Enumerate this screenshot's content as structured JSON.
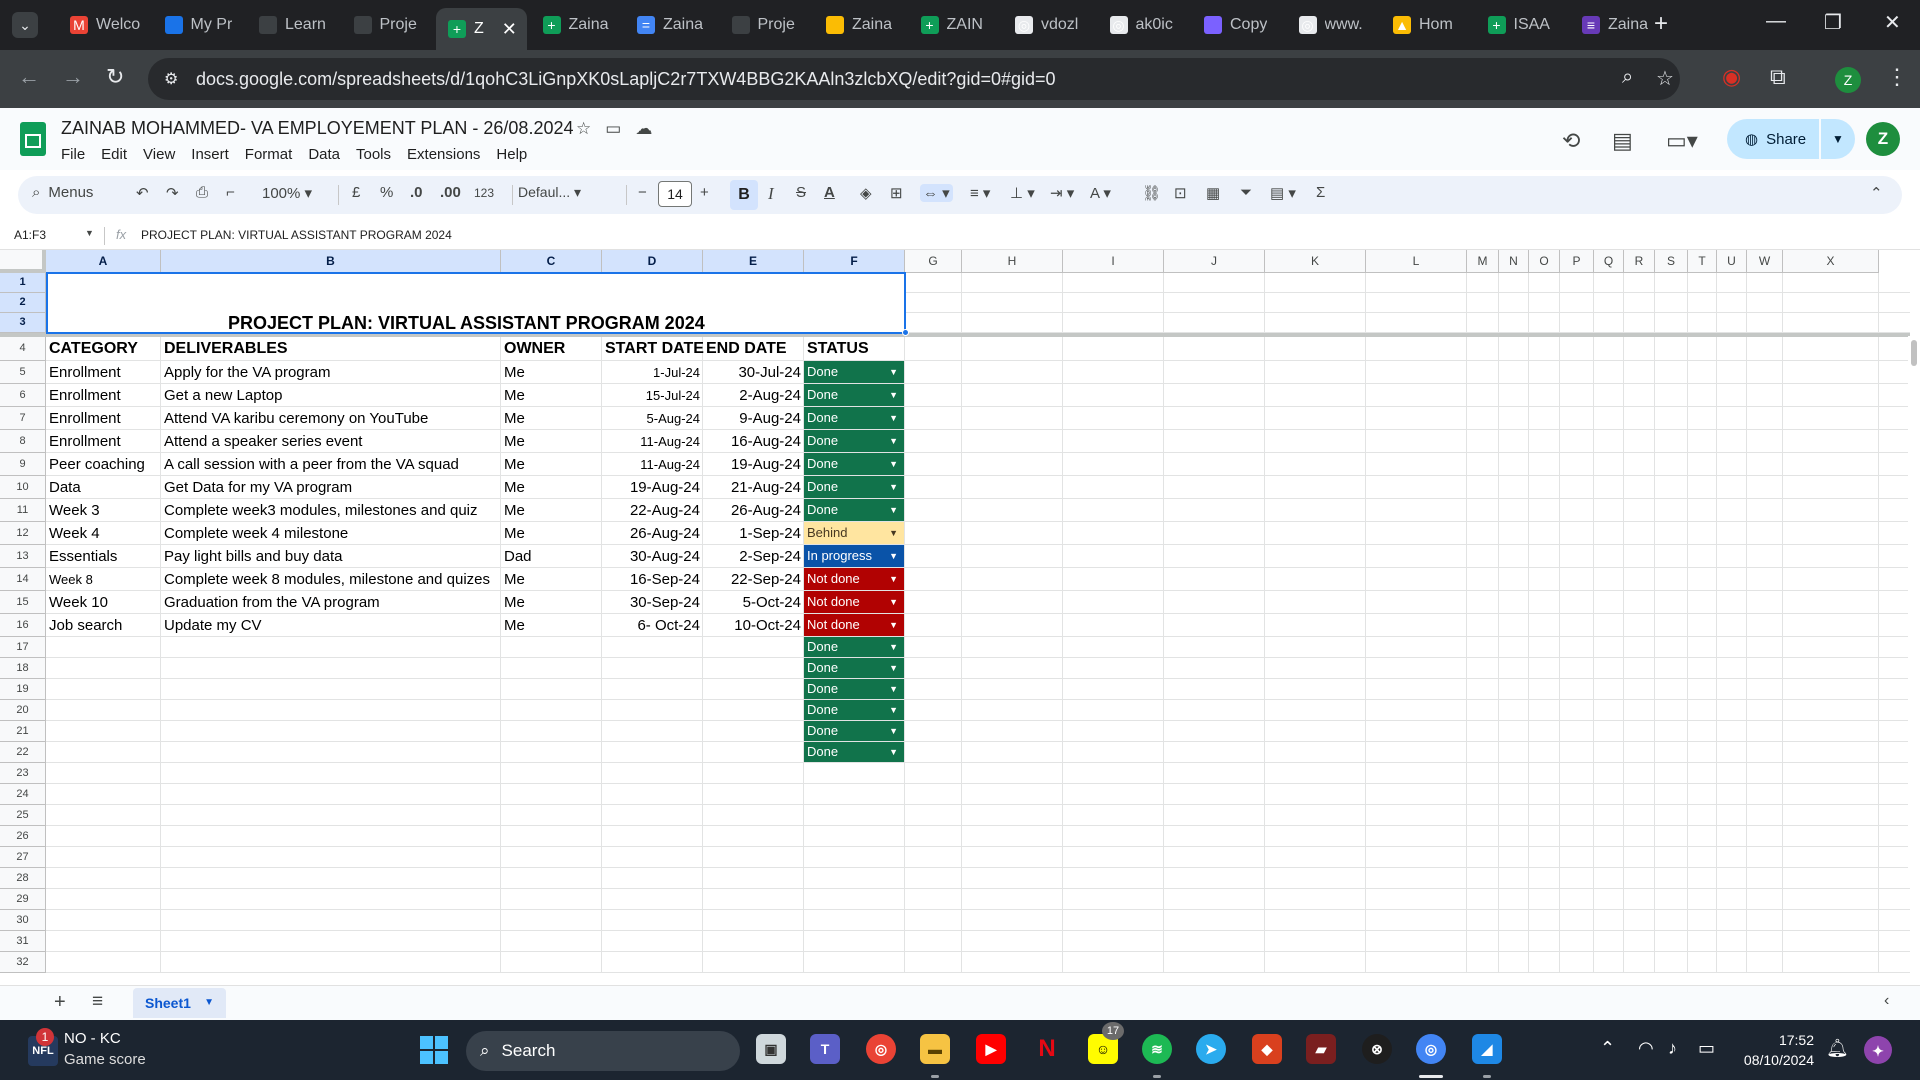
{
  "browser": {
    "tabs": [
      {
        "title": "Welco",
        "color": "#ea4335",
        "glyph": "M"
      },
      {
        "title": "My Pr",
        "color": "#1a73e8",
        "glyph": ""
      },
      {
        "title": "Learn",
        "color": "#3c4043",
        "glyph": ""
      },
      {
        "title": "Proje",
        "color": "#3c4043",
        "glyph": ""
      },
      {
        "title": "Z",
        "color": "#0f9d58",
        "glyph": "+",
        "active": true
      },
      {
        "title": "Zaina",
        "color": "#0f9d58",
        "glyph": "+"
      },
      {
        "title": "Zaina",
        "color": "#4285f4",
        "glyph": "="
      },
      {
        "title": "Proje",
        "color": "#3c4043",
        "glyph": ""
      },
      {
        "title": "Zaina",
        "color": "#fbbc04",
        "glyph": ""
      },
      {
        "title": "ZAIN",
        "color": "#0f9d58",
        "glyph": "+"
      },
      {
        "title": "vdozl",
        "color": "#e8eaed",
        "glyph": "◎"
      },
      {
        "title": "ak0ic",
        "color": "#e8eaed",
        "glyph": "◎"
      },
      {
        "title": "Copy",
        "color": "#7b61ff",
        "glyph": ""
      },
      {
        "title": "www.",
        "color": "#e8eaed",
        "glyph": "◎"
      },
      {
        "title": "Hom",
        "color": "#fbbc04",
        "glyph": "▲"
      },
      {
        "title": "ISAA",
        "color": "#0f9d58",
        "glyph": "+"
      },
      {
        "title": "Zaina",
        "color": "#673ab7",
        "glyph": "≡"
      }
    ],
    "url": "docs.google.com/spreadsheets/d/1qohC3LiGnpXK0sLapljC2r7TXW4BBG2KAAln3zlcbXQ/edit?gid=0#gid=0",
    "profile_initial": "Z"
  },
  "sheets": {
    "doc_title": "ZAINAB MOHAMMED- VA EMPLOYEMENT PLAN - 26/08.2024",
    "menu": [
      "File",
      "Edit",
      "View",
      "Insert",
      "Format",
      "Data",
      "Tools",
      "Extensions",
      "Help"
    ],
    "share_label": "Share",
    "user_initial": "Z",
    "toolbar": {
      "menus_label": "Menus",
      "zoom": "100%",
      "currency": "£",
      "percent": "%",
      "dec_decrease": ".0",
      "dec_increase": ".00",
      "format_123": "123",
      "font": "Defaul...",
      "font_size": "14",
      "bold": "B",
      "italic": "I",
      "strike": "S",
      "text_color": "A",
      "text_rotate": "A",
      "function": "Σ"
    },
    "namebox": "A1:F3",
    "formula": "PROJECT PLAN: VIRTUAL ASSISTANT PROGRAM 2024",
    "columns": [
      "A",
      "B",
      "C",
      "D",
      "E",
      "F",
      "G",
      "H",
      "I",
      "J",
      "K",
      "L",
      "M",
      "N",
      "O",
      "P",
      "Q",
      "R",
      "S",
      "T",
      "U",
      "W",
      "X"
    ],
    "banner_title": "PROJECT PLAN: VIRTUAL ASSISTANT PROGRAM 2024",
    "table_headers": [
      "CATEGORY",
      "DELIVERABLES",
      "OWNER",
      "START DATE",
      "END DATE",
      "STATUS"
    ],
    "rows": [
      {
        "category": "Enrollment",
        "deliverable": "Apply for the VA program",
        "owner": "Me",
        "start": "1-Jul-24",
        "end": "30-Jul-24",
        "status": "Done",
        "start_small": true
      },
      {
        "category": "Enrollment",
        "deliverable": "Get a new Laptop",
        "owner": "Me",
        "start": "15-Jul-24",
        "end": "2-Aug-24",
        "status": "Done",
        "start_small": true
      },
      {
        "category": "Enrollment",
        "deliverable": "Attend VA karibu ceremony on YouTube",
        "owner": "Me",
        "start": "5-Aug-24",
        "end": "9-Aug-24",
        "status": "Done",
        "start_small": true
      },
      {
        "category": "Enrollment",
        "deliverable": "Attend a  speaker series event",
        "owner": "Me",
        "start": "11-Aug-24",
        "end": "16-Aug-24",
        "status": "Done",
        "start_small": true
      },
      {
        "category": "Peer coaching",
        "deliverable": "A call session  with a peer from the VA squad",
        "owner": "Me",
        "start": "11-Aug-24",
        "end": "19-Aug-24",
        "status": "Done",
        "start_small": true
      },
      {
        "category": "Data",
        "deliverable": "Get  Data for my VA program",
        "owner": "Me",
        "start": "19-Aug-24",
        "end": "21-Aug-24",
        "status": "Done"
      },
      {
        "category": "Week 3",
        "deliverable": "Complete week3 modules, milestones and quiz",
        "owner": "Me",
        "start": "22-Aug-24",
        "end": "26-Aug-24",
        "status": "Done"
      },
      {
        "category": "Week 4",
        "deliverable": "Complete week 4 milestone",
        "owner": "Me",
        "start": "26-Aug-24",
        "end": "1-Sep-24",
        "status": "Behind"
      },
      {
        "category": "Essentials",
        "deliverable": "Pay light bills and buy data",
        "owner": "Dad",
        "start": "30-Aug-24",
        "end": "2-Sep-24",
        "status": "In progress"
      },
      {
        "category": "Week 8",
        "deliverable": "Complete week 8 modules, milestone and quizes",
        "owner": "Me",
        "start": "16-Sep-24",
        "end": "22-Sep-24",
        "status": "Not done",
        "cat_small": true
      },
      {
        "category": "Week 10",
        "deliverable": "Graduation from the VA program",
        "owner": "Me",
        "start": "30-Sep-24",
        "end": "5-Oct-24",
        "status": "Not done"
      },
      {
        "category": "Job search",
        "deliverable": "Update my CV",
        "owner": "Me",
        "start": "6- Oct-24",
        "end": "10-Oct-24",
        "status": "Not done"
      }
    ],
    "extra_status": [
      "Done",
      "Done",
      "Done",
      "Done",
      "Done",
      "Done"
    ],
    "status_colors": {
      "Done": "#11734b",
      "Behind": "#ffe5a0",
      "In progress": "#0a53a8",
      "Not done": "#b10202"
    },
    "status_text_colors": {
      "Done": "#ffffff",
      "Behind": "#473821",
      "In progress": "#ffffff",
      "Not done": "#ffffff"
    },
    "sheet_tab": "Sheet1"
  },
  "taskbar": {
    "news_badge": "1",
    "news_title": "NO - KC",
    "news_subtitle": "Game score",
    "search_label": "Search",
    "snapchat_badge": "17",
    "time": "17:52",
    "date": "08/10/2024"
  }
}
